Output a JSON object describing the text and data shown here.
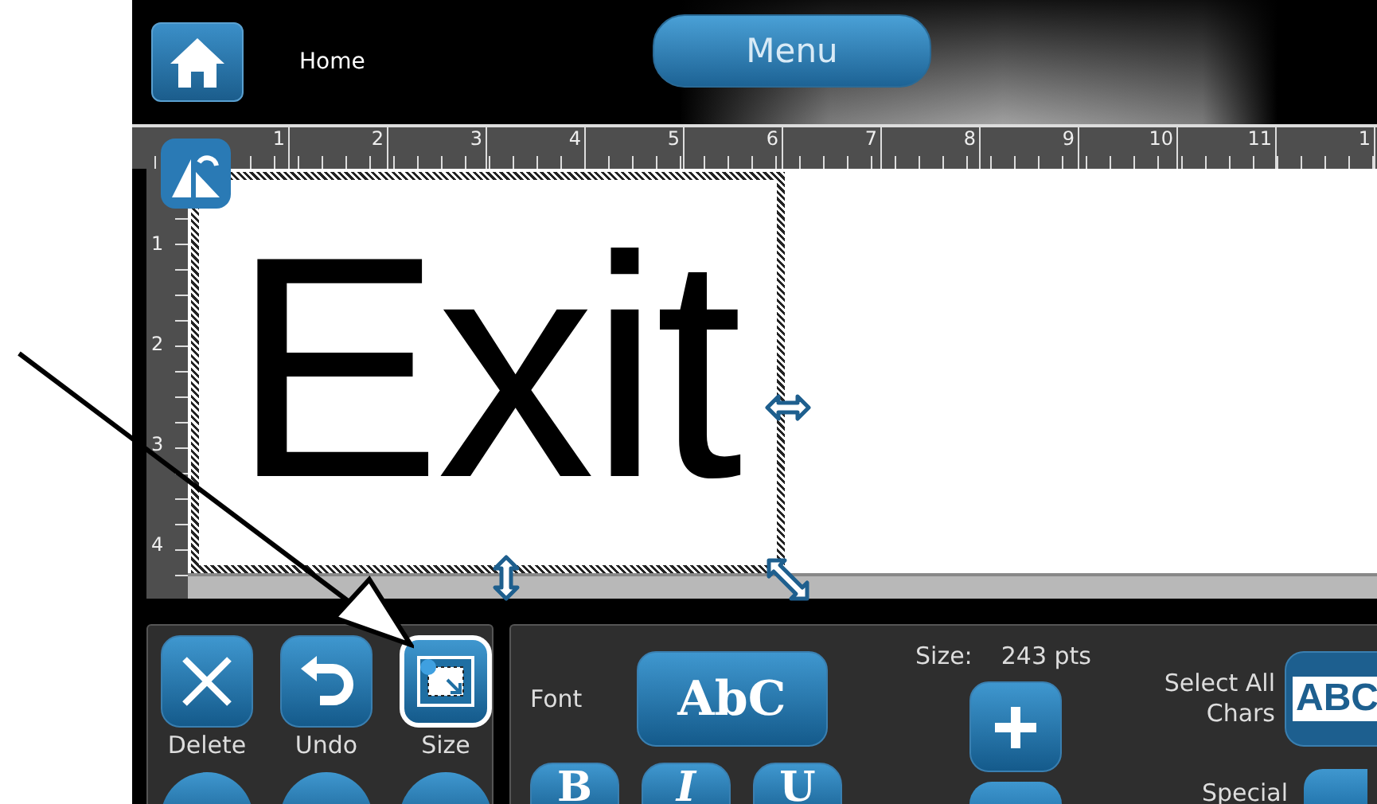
{
  "top_bar": {
    "home_label": "Home",
    "menu_button": "Menu"
  },
  "ruler": {
    "top_labels": [
      "1",
      "2",
      "3",
      "4",
      "5",
      "6",
      "7",
      "8",
      "9",
      "10",
      "11",
      "1"
    ],
    "side_labels": [
      "1",
      "2",
      "3",
      "4"
    ]
  },
  "label": {
    "text": "Exit"
  },
  "tools": [
    {
      "label": "Delete",
      "kind": "delete",
      "selected": false
    },
    {
      "label": "Undo",
      "kind": "undo",
      "selected": false
    },
    {
      "label": "Size",
      "kind": "size",
      "selected": true
    }
  ],
  "text_panel": {
    "font_label": "Font",
    "font_button": "AbC",
    "size_label": "Size:",
    "size_value": "243 pts",
    "style_buttons": [
      "B",
      "I",
      "U"
    ],
    "select_label": "Select All Chars",
    "select_button": "ABC",
    "special_label": "Special"
  }
}
